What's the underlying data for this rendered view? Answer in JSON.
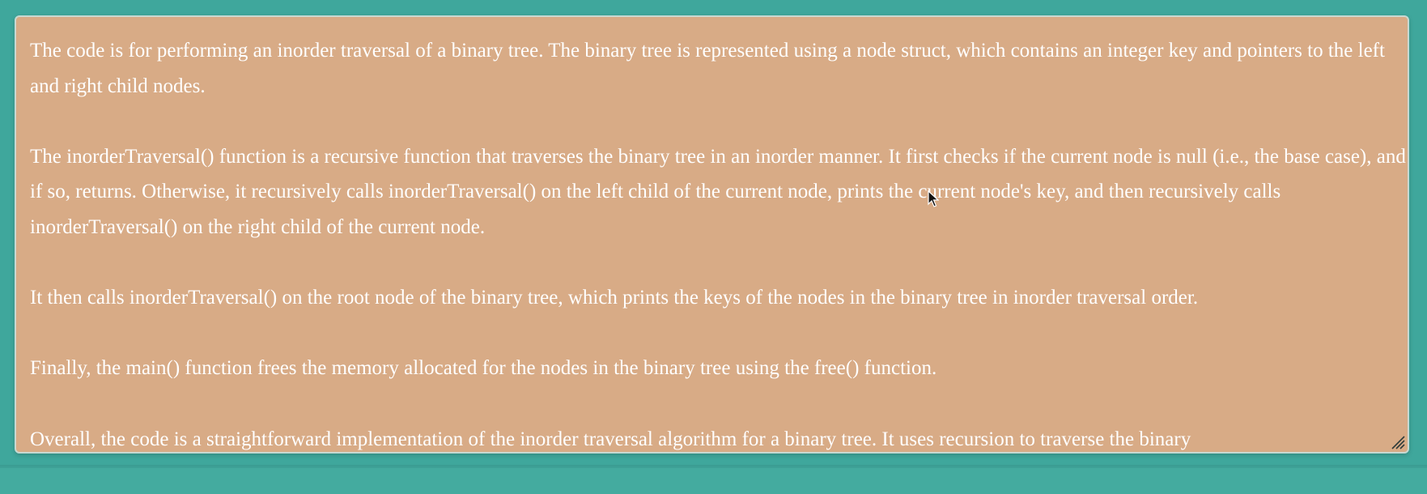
{
  "textarea": {
    "paragraphs": [
      "The code is for performing an inorder traversal of a binary tree. The binary tree is represented using a node struct, which contains an integer key and pointers to the left and right child nodes.",
      "The inorderTraversal() function is a recursive function that traverses the binary tree in an inorder manner. It first checks if the current node is null (i.e., the base case), and if so, returns. Otherwise, it recursively calls inorderTraversal() on the left child of the current node, prints the current node's key, and then recursively calls inorderTraversal() on the right child of the current node.",
      "It then calls inorderTraversal() on the root node of the binary tree, which prints the keys of the nodes in the binary tree in inorder traversal order.",
      "Finally, the main() function frees the memory allocated for the nodes in the binary tree using the free() function.",
      "Overall, the code is a straightforward implementation of the inorder traversal algorithm for a binary tree. It uses recursion to traverse the binary"
    ]
  },
  "colors": {
    "background": "#3fa79c",
    "textarea_background": "#d8ab86",
    "text": "#ffffff"
  },
  "icons": {
    "resize_handle": "resize-grip-icon",
    "mouse_pointer": "mouse-cursor-icon"
  }
}
